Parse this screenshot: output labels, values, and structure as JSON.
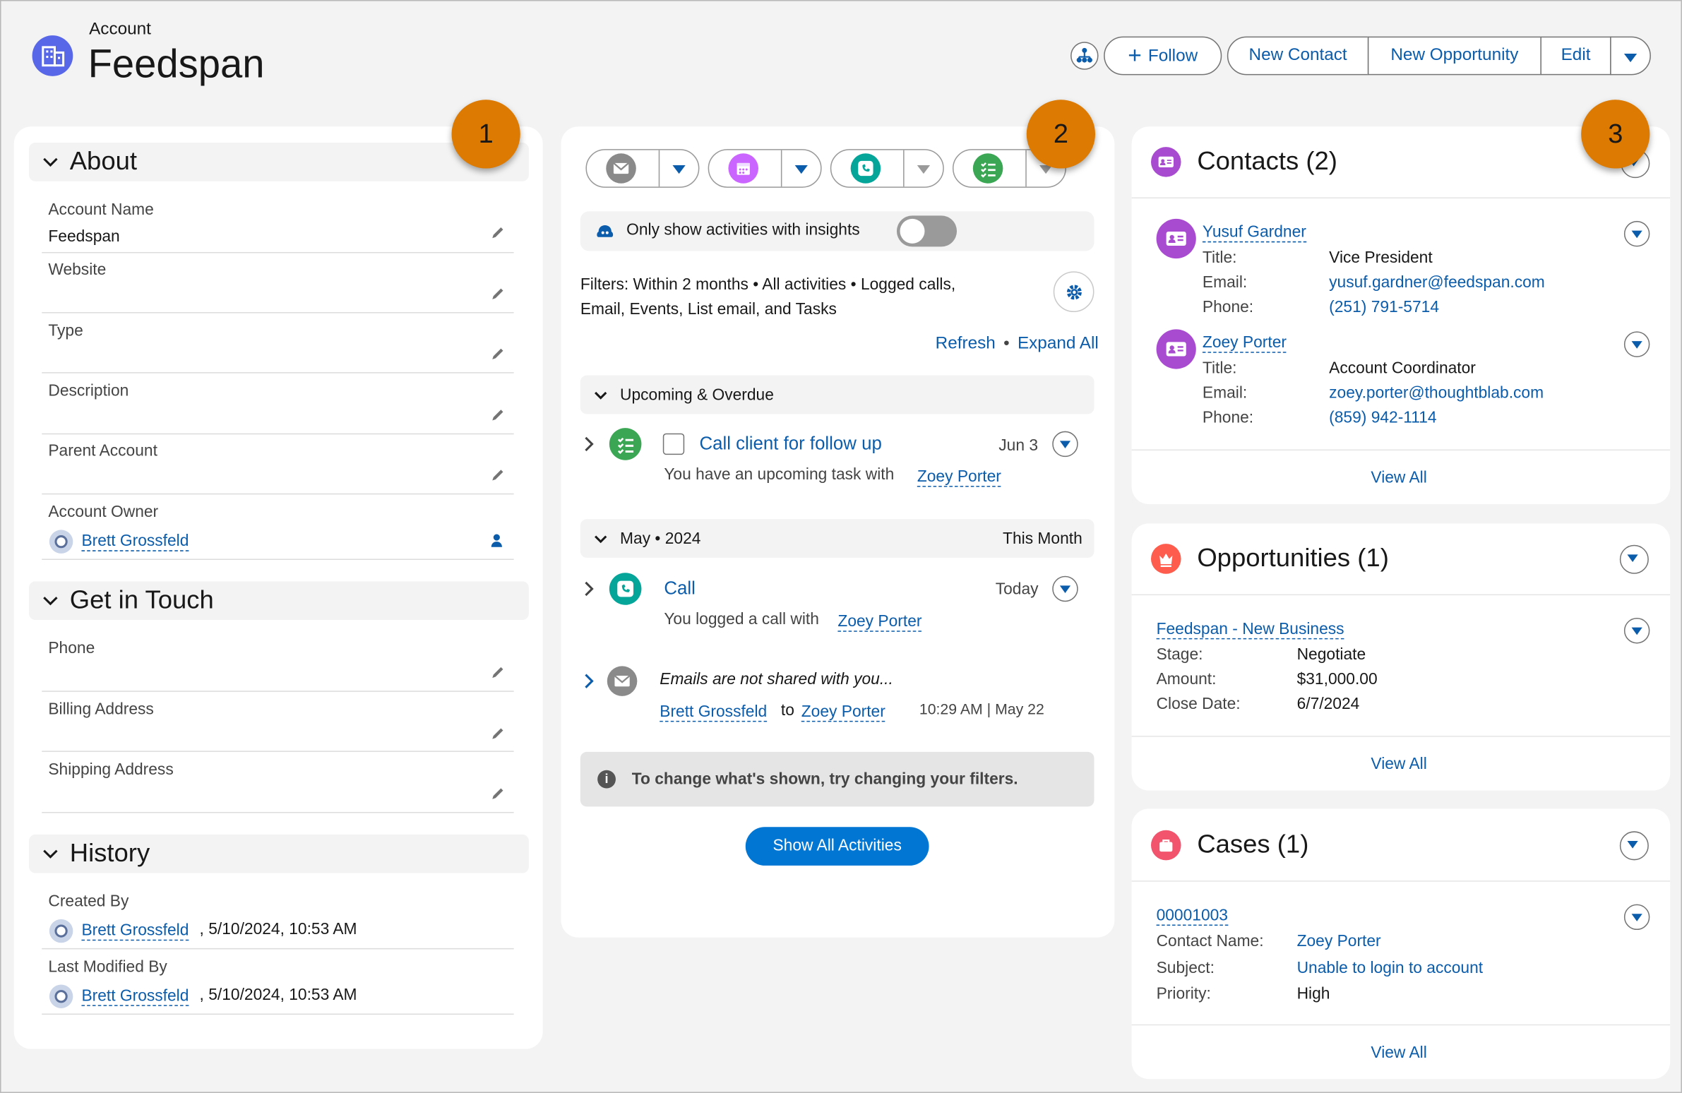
{
  "header": {
    "object_label": "Account",
    "record_name": "Feedspan",
    "buttons": {
      "follow": "Follow",
      "new_contact": "New Contact",
      "new_opportunity": "New Opportunity",
      "edit": "Edit"
    }
  },
  "badges": [
    "1",
    "2",
    "3"
  ],
  "details": {
    "about": {
      "title": "About",
      "fields": [
        {
          "label": "Account Name",
          "value": "Feedspan"
        },
        {
          "label": "Website",
          "value": ""
        },
        {
          "label": "Type",
          "value": ""
        },
        {
          "label": "Description",
          "value": ""
        },
        {
          "label": "Parent Account",
          "value": ""
        },
        {
          "label": "Account Owner",
          "value": "Brett Grossfeld"
        }
      ]
    },
    "get_in_touch": {
      "title": "Get in Touch",
      "fields": [
        {
          "label": "Phone",
          "value": ""
        },
        {
          "label": "Billing Address",
          "value": ""
        },
        {
          "label": "Shipping Address",
          "value": ""
        }
      ]
    },
    "history": {
      "title": "History",
      "created_by": {
        "label": "Created By",
        "user": "Brett Grossfeld",
        "date": ", 5/10/2024, 10:53 AM"
      },
      "modified_by": {
        "label": "Last Modified By",
        "user": "Brett Grossfeld",
        "date": ", 5/10/2024, 10:53 AM"
      }
    }
  },
  "activity": {
    "insights_label": "Only show activities with insights",
    "insights_on": false,
    "filters_text_1": "Filters: Within 2 months • All activities • Logged calls,",
    "filters_text_2": "Email, Events, List email, and Tasks",
    "refresh": "Refresh",
    "dot": "•",
    "expand_all": "Expand All",
    "upcoming": {
      "title": "Upcoming & Overdue",
      "task": {
        "subject": "Call client for follow up",
        "date": "Jun 3",
        "desc": "You have an upcoming task with",
        "who": "Zoey Porter"
      }
    },
    "month": {
      "title": "May • 2024",
      "badge": "This Month",
      "call": {
        "subject": "Call",
        "date": "Today",
        "desc": "You logged a call with",
        "who": "Zoey Porter"
      },
      "email": {
        "subject": "Emails are not shared with you...",
        "from": "Brett Grossfeld",
        "to_word": "to",
        "to": "Zoey Porter",
        "datetime": "10:29 AM | May 22"
      }
    },
    "notice": "To change what's shown, try changing your filters.",
    "show_all": "Show All Activities"
  },
  "related": {
    "contacts": {
      "title": "Contacts (2)",
      "items": [
        {
          "name": "Yusuf Gardner",
          "title_label": "Title:",
          "title": "Vice President",
          "email_label": "Email:",
          "email": "yusuf.gardner@feedspan.com",
          "phone_label": "Phone:",
          "phone": "(251) 791-5714"
        },
        {
          "name": "Zoey Porter",
          "title_label": "Title:",
          "title": "Account Coordinator",
          "email_label": "Email:",
          "email": "zoey.porter@thoughtblab.com",
          "phone_label": "Phone:",
          "phone": "(859) 942-1114"
        }
      ],
      "view_all": "View All"
    },
    "opportunities": {
      "title": "Opportunities (1)",
      "item": {
        "name": "Feedspan - New Business",
        "stage_label": "Stage:",
        "stage": "Negotiate",
        "amount_label": "Amount:",
        "amount": "$31,000.00",
        "close_label": "Close Date:",
        "close": "6/7/2024"
      },
      "view_all": "View All"
    },
    "cases": {
      "title": "Cases (1)",
      "item": {
        "number": "00001003",
        "contact_label": "Contact Name:",
        "contact": "Zoey Porter",
        "subject_label": "Subject:",
        "subject": "Unable to login to account",
        "priority_label": "Priority:",
        "priority": "High"
      },
      "view_all": "View All"
    }
  },
  "colors": {
    "brand": "#0b5cab",
    "badge": "#dd7a01",
    "account_icon": "#5867e8",
    "contact_icon": "#a94bd1",
    "opportunity_icon": "#fe5c4c",
    "case_icon": "#f2536d",
    "task_icon": "#3ba755",
    "call_icon": "#06a59a",
    "email_icon": "#8a8a8a",
    "event_icon": "#cb65ff"
  }
}
